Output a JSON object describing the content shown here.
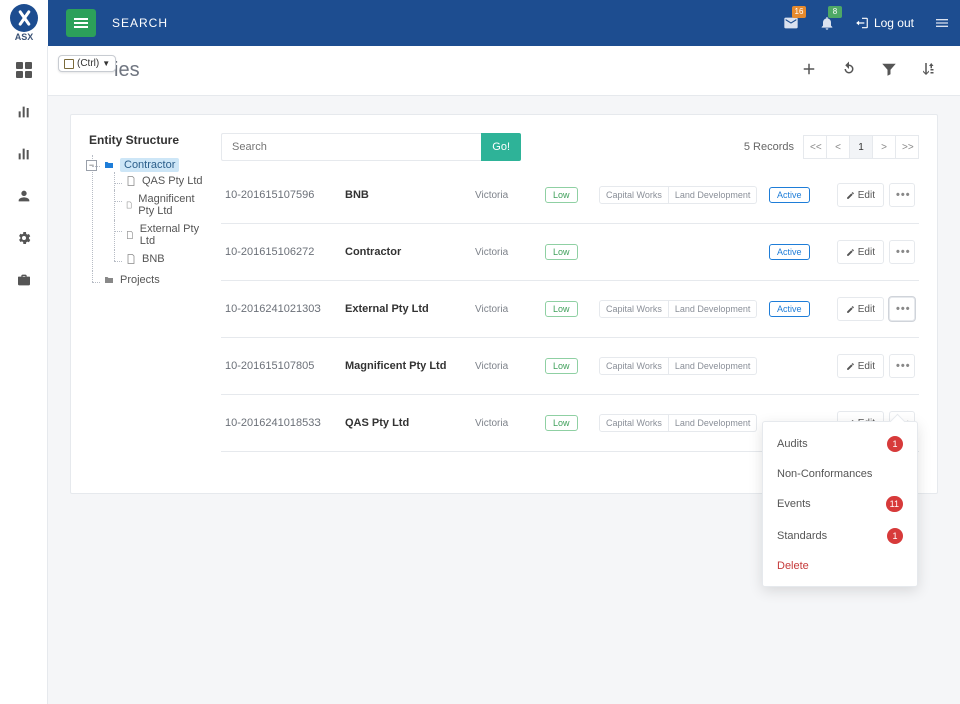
{
  "brand": "ASX",
  "topbar": {
    "search_label": "SEARCH",
    "notif_count": "16",
    "bell_count": "8",
    "logout": "Log out"
  },
  "ctrl_pill": "(Ctrl)",
  "page": {
    "title_suffix": "ies",
    "records_label": "5 Records"
  },
  "actions": {
    "go": "Go!",
    "edit": "Edit",
    "search_placeholder": "Search",
    "pager": {
      "first": "<<",
      "prev": "<",
      "current": "1",
      "next": ">",
      "last": ">>"
    }
  },
  "tree": {
    "title": "Entity Structure",
    "root": {
      "label": "Contractor",
      "children": [
        {
          "label": "QAS Pty Ltd"
        },
        {
          "label": "Magnificent Pty Ltd"
        },
        {
          "label": "External Pty Ltd"
        },
        {
          "label": "BNB"
        }
      ]
    },
    "projects": "Projects"
  },
  "tags": {
    "cw": "Capital Works",
    "ld": "Land Development"
  },
  "risk_low": "Low",
  "status_active": "Active",
  "rows": [
    {
      "id": "10-201615107596",
      "name": "BNB",
      "region": "Victoria",
      "risk": "Low",
      "tags": true,
      "status": "Active"
    },
    {
      "id": "10-201615106272",
      "name": "Contractor",
      "region": "Victoria",
      "risk": "Low",
      "tags": false,
      "status": "Active"
    },
    {
      "id": "10-201624102130З",
      "name": "External Pty Ltd",
      "region": "Victoria",
      "risk": "Low",
      "tags": true,
      "status": "Active"
    },
    {
      "id": "10-201615107805",
      "name": "Magnificent Pty Ltd",
      "region": "Victoria",
      "risk": "Low",
      "tags": true,
      "status": ""
    },
    {
      "id": "10-201624101853З",
      "name": "QAS Pty Ltd",
      "region": "Victoria",
      "risk": "Low",
      "tags": true,
      "status": ""
    }
  ],
  "dropdown": [
    {
      "label": "Audits",
      "count": "1"
    },
    {
      "label": "Non-Conformances",
      "count": ""
    },
    {
      "label": "Events",
      "count": "11"
    },
    {
      "label": "Standards",
      "count": "1"
    },
    {
      "label": "Delete",
      "count": "",
      "danger": true
    }
  ]
}
